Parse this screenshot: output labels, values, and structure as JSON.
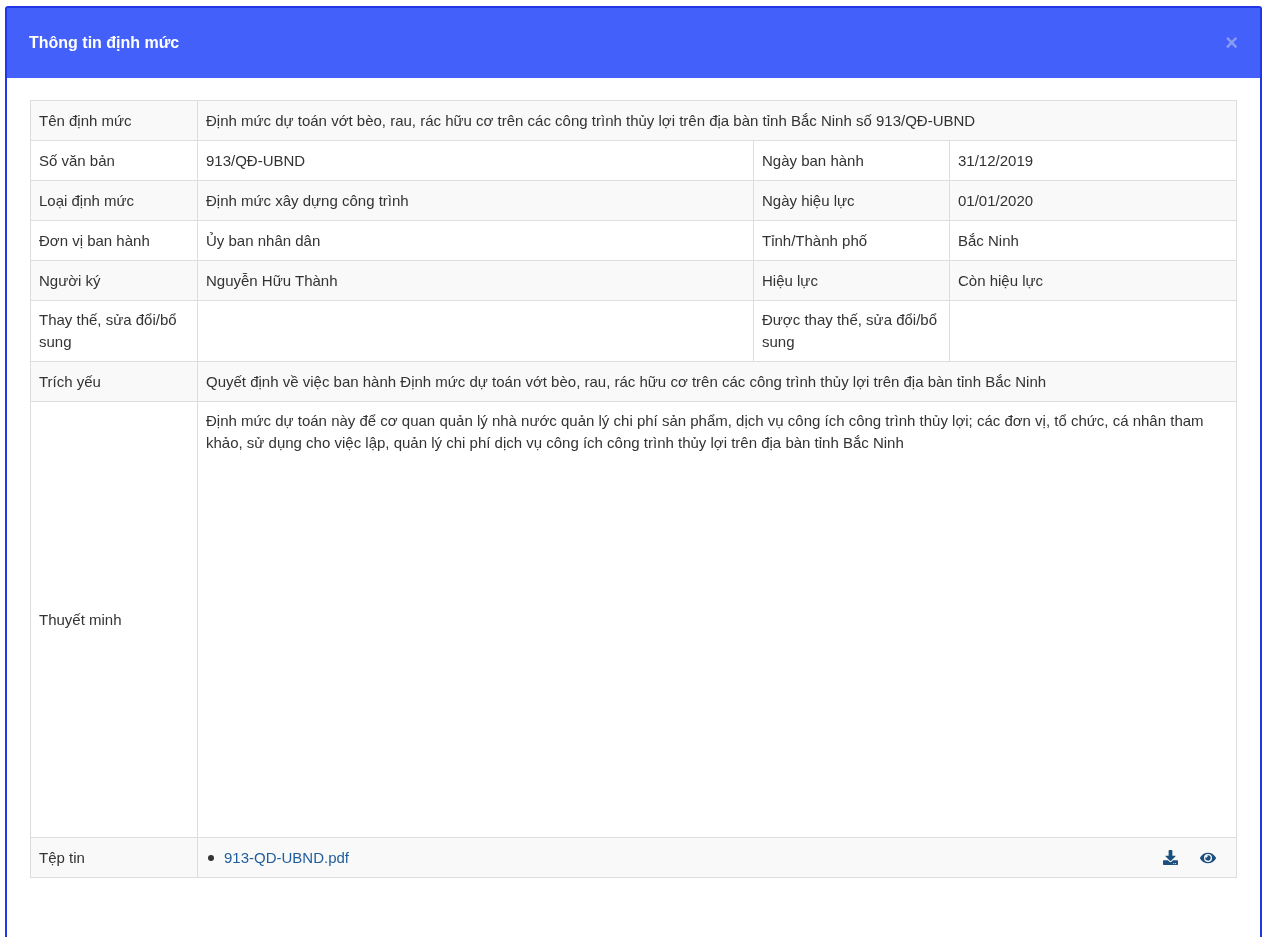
{
  "dialog": {
    "title": "Thông tin định mức",
    "close": "×"
  },
  "rows": [
    {
      "kind": "text",
      "fields": [
        {
          "label": "Tên định mức",
          "value": "Định mức dự toán vớt bèo, rau, rác hữu cơ trên các công trình thủy lợi trên địa bàn tỉnh Bắc Ninh số 913/QĐ-UBND"
        }
      ]
    },
    {
      "kind": "text",
      "fields": [
        {
          "label": "Số văn bản",
          "value": "913/QĐ-UBND"
        },
        {
          "label": "Ngày ban hành",
          "value": "31/12/2019"
        }
      ]
    },
    {
      "kind": "text",
      "fields": [
        {
          "label": "Loại định mức",
          "value": "Định mức xây dựng công trình"
        },
        {
          "label": "Ngày hiệu lực",
          "value": "01/01/2020"
        }
      ]
    },
    {
      "kind": "text",
      "fields": [
        {
          "label": "Đơn vị ban hành",
          "value": "Ủy ban nhân dân"
        },
        {
          "label": "Tỉnh/Thành phố",
          "value": "Bắc Ninh"
        }
      ]
    },
    {
      "kind": "text",
      "fields": [
        {
          "label": "Người ký",
          "value": "Nguyễn Hữu Thành"
        },
        {
          "label": "Hiệu lực",
          "value": "Còn hiệu lực"
        }
      ]
    },
    {
      "kind": "text",
      "fields": [
        {
          "label": "Thay thế, sửa đổi/bổ sung"
        },
        {
          "label": "Được thay thế, sửa đổi/bổ sung"
        }
      ]
    },
    {
      "kind": "text",
      "fields": [
        {
          "label": "Trích yếu",
          "value": "Quyết định về việc ban hành Định mức dự toán vớt bèo, rau, rác hữu cơ trên các công trình thủy lợi trên địa bàn tỉnh Bắc Ninh"
        }
      ]
    },
    {
      "kind": "note",
      "fields": [
        {
          "label": "Thuyết minh",
          "value": "Định mức dự toán này để cơ quan quản lý nhà nước quản lý chi phí sản phẩm, dịch vụ công ích công trình thủy lợi; các đơn vị, tổ chức, cá nhân tham khảo, sử dụng cho việc lập, quản lý chi phí dịch vụ công ích công trình thủy lợi trên địa bàn tỉnh Bắc Ninh"
        }
      ]
    },
    {
      "kind": "file",
      "label": "Tệp tin",
      "files": [
        "913-QD-UBND.pdf"
      ]
    }
  ]
}
